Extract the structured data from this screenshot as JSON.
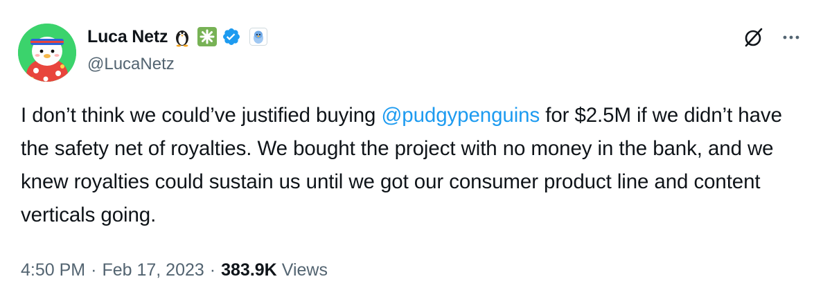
{
  "author": {
    "display_name": "Luca Netz",
    "handle": "@LucaNetz",
    "badges": [
      "penguin-emoji-icon",
      "sparkle-emoji-icon",
      "verified-badge-icon",
      "affiliate-badge-icon"
    ],
    "avatar": "pudgy-penguin-avatar",
    "avatar_bg_color": "#3bd36c"
  },
  "header_actions": {
    "grok_icon": "grok-icon",
    "more_icon": "more-icon"
  },
  "tweet": {
    "text_before": "I don’t think we could’ve justified buying ",
    "mention": "@pudgypenguins",
    "text_after": " for $2.5M if we didn’t have the safety net of royalties. We bought the project with no money in the bank, and we knew royalties could sustain us until we got our consumer product line and content verticals going."
  },
  "meta": {
    "time": "4:50 PM",
    "separator": "·",
    "date": "Feb 17, 2023",
    "views_count": "383.9K",
    "views_label": "Views"
  },
  "colors": {
    "link": "#1d9bf0",
    "secondary_text": "#536471",
    "primary_text": "#0f1419",
    "verified": "#1d9bf0"
  }
}
